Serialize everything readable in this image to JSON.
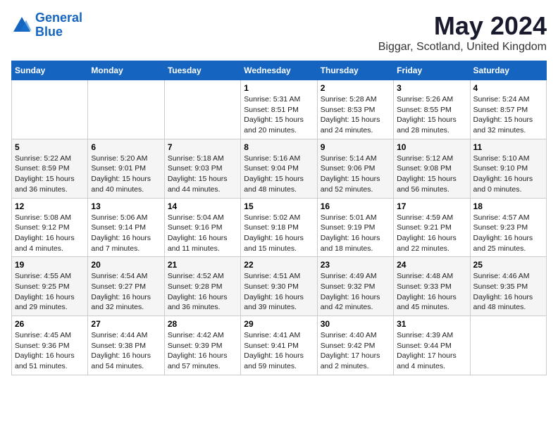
{
  "header": {
    "logo_line1": "General",
    "logo_line2": "Blue",
    "month_title": "May 2024",
    "location": "Biggar, Scotland, United Kingdom"
  },
  "weekdays": [
    "Sunday",
    "Monday",
    "Tuesday",
    "Wednesday",
    "Thursday",
    "Friday",
    "Saturday"
  ],
  "weeks": [
    [
      {
        "day": "",
        "content": ""
      },
      {
        "day": "",
        "content": ""
      },
      {
        "day": "",
        "content": ""
      },
      {
        "day": "1",
        "content": "Sunrise: 5:31 AM\nSunset: 8:51 PM\nDaylight: 15 hours\nand 20 minutes."
      },
      {
        "day": "2",
        "content": "Sunrise: 5:28 AM\nSunset: 8:53 PM\nDaylight: 15 hours\nand 24 minutes."
      },
      {
        "day": "3",
        "content": "Sunrise: 5:26 AM\nSunset: 8:55 PM\nDaylight: 15 hours\nand 28 minutes."
      },
      {
        "day": "4",
        "content": "Sunrise: 5:24 AM\nSunset: 8:57 PM\nDaylight: 15 hours\nand 32 minutes."
      }
    ],
    [
      {
        "day": "5",
        "content": "Sunrise: 5:22 AM\nSunset: 8:59 PM\nDaylight: 15 hours\nand 36 minutes."
      },
      {
        "day": "6",
        "content": "Sunrise: 5:20 AM\nSunset: 9:01 PM\nDaylight: 15 hours\nand 40 minutes."
      },
      {
        "day": "7",
        "content": "Sunrise: 5:18 AM\nSunset: 9:03 PM\nDaylight: 15 hours\nand 44 minutes."
      },
      {
        "day": "8",
        "content": "Sunrise: 5:16 AM\nSunset: 9:04 PM\nDaylight: 15 hours\nand 48 minutes."
      },
      {
        "day": "9",
        "content": "Sunrise: 5:14 AM\nSunset: 9:06 PM\nDaylight: 15 hours\nand 52 minutes."
      },
      {
        "day": "10",
        "content": "Sunrise: 5:12 AM\nSunset: 9:08 PM\nDaylight: 15 hours\nand 56 minutes."
      },
      {
        "day": "11",
        "content": "Sunrise: 5:10 AM\nSunset: 9:10 PM\nDaylight: 16 hours\nand 0 minutes."
      }
    ],
    [
      {
        "day": "12",
        "content": "Sunrise: 5:08 AM\nSunset: 9:12 PM\nDaylight: 16 hours\nand 4 minutes."
      },
      {
        "day": "13",
        "content": "Sunrise: 5:06 AM\nSunset: 9:14 PM\nDaylight: 16 hours\nand 7 minutes."
      },
      {
        "day": "14",
        "content": "Sunrise: 5:04 AM\nSunset: 9:16 PM\nDaylight: 16 hours\nand 11 minutes."
      },
      {
        "day": "15",
        "content": "Sunrise: 5:02 AM\nSunset: 9:18 PM\nDaylight: 16 hours\nand 15 minutes."
      },
      {
        "day": "16",
        "content": "Sunrise: 5:01 AM\nSunset: 9:19 PM\nDaylight: 16 hours\nand 18 minutes."
      },
      {
        "day": "17",
        "content": "Sunrise: 4:59 AM\nSunset: 9:21 PM\nDaylight: 16 hours\nand 22 minutes."
      },
      {
        "day": "18",
        "content": "Sunrise: 4:57 AM\nSunset: 9:23 PM\nDaylight: 16 hours\nand 25 minutes."
      }
    ],
    [
      {
        "day": "19",
        "content": "Sunrise: 4:55 AM\nSunset: 9:25 PM\nDaylight: 16 hours\nand 29 minutes."
      },
      {
        "day": "20",
        "content": "Sunrise: 4:54 AM\nSunset: 9:27 PM\nDaylight: 16 hours\nand 32 minutes."
      },
      {
        "day": "21",
        "content": "Sunrise: 4:52 AM\nSunset: 9:28 PM\nDaylight: 16 hours\nand 36 minutes."
      },
      {
        "day": "22",
        "content": "Sunrise: 4:51 AM\nSunset: 9:30 PM\nDaylight: 16 hours\nand 39 minutes."
      },
      {
        "day": "23",
        "content": "Sunrise: 4:49 AM\nSunset: 9:32 PM\nDaylight: 16 hours\nand 42 minutes."
      },
      {
        "day": "24",
        "content": "Sunrise: 4:48 AM\nSunset: 9:33 PM\nDaylight: 16 hours\nand 45 minutes."
      },
      {
        "day": "25",
        "content": "Sunrise: 4:46 AM\nSunset: 9:35 PM\nDaylight: 16 hours\nand 48 minutes."
      }
    ],
    [
      {
        "day": "26",
        "content": "Sunrise: 4:45 AM\nSunset: 9:36 PM\nDaylight: 16 hours\nand 51 minutes."
      },
      {
        "day": "27",
        "content": "Sunrise: 4:44 AM\nSunset: 9:38 PM\nDaylight: 16 hours\nand 54 minutes."
      },
      {
        "day": "28",
        "content": "Sunrise: 4:42 AM\nSunset: 9:39 PM\nDaylight: 16 hours\nand 57 minutes."
      },
      {
        "day": "29",
        "content": "Sunrise: 4:41 AM\nSunset: 9:41 PM\nDaylight: 16 hours\nand 59 minutes."
      },
      {
        "day": "30",
        "content": "Sunrise: 4:40 AM\nSunset: 9:42 PM\nDaylight: 17 hours\nand 2 minutes."
      },
      {
        "day": "31",
        "content": "Sunrise: 4:39 AM\nSunset: 9:44 PM\nDaylight: 17 hours\nand 4 minutes."
      },
      {
        "day": "",
        "content": ""
      }
    ]
  ]
}
